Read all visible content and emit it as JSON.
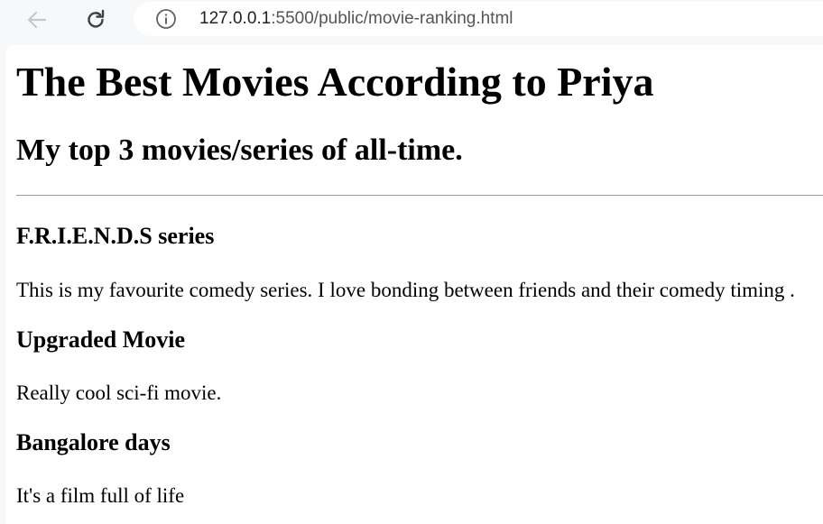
{
  "browser": {
    "url_host": "127.0.0.1",
    "url_rest": ":5500/public/movie-ranking.html"
  },
  "page": {
    "title": "The Best Movies According to Priya",
    "subtitle": "My top 3 movies/series of all-time.",
    "movies": [
      {
        "name": "F.R.I.E.N.D.S series",
        "description": "This is my favourite comedy series. I love bonding between friends and their comedy timing ."
      },
      {
        "name": "Upgraded Movie",
        "description": "Really cool sci-fi movie."
      },
      {
        "name": "Bangalore days",
        "description": "It's a film full of life"
      }
    ]
  }
}
